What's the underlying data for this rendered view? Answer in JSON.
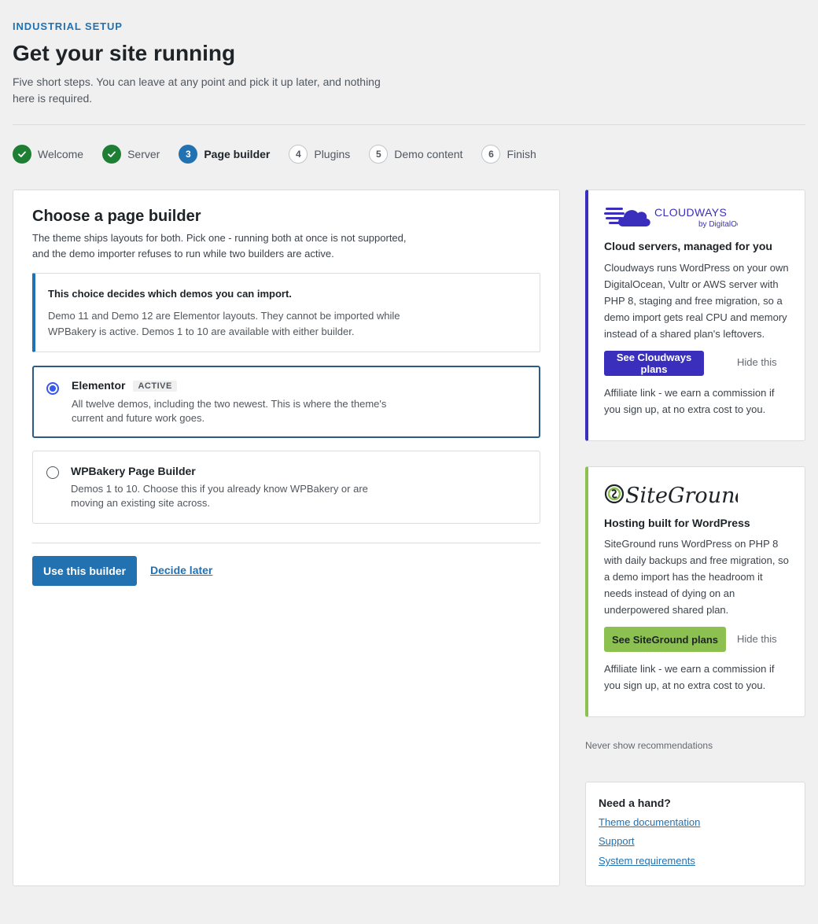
{
  "header": {
    "eyebrow": "INDUSTRIAL SETUP",
    "title": "Get your site running",
    "subtitle": "Five short steps. You can leave at any point and pick it up later, and nothing here is required."
  },
  "steps": [
    {
      "number": "1",
      "label": "Welcome",
      "status": "done"
    },
    {
      "number": "2",
      "label": "Server",
      "status": "done"
    },
    {
      "number": "3",
      "label": "Page builder",
      "status": "current"
    },
    {
      "number": "4",
      "label": "Plugins",
      "status": "todo"
    },
    {
      "number": "5",
      "label": "Demo content",
      "status": "todo"
    },
    {
      "number": "6",
      "label": "Finish",
      "status": "todo"
    }
  ],
  "main": {
    "title": "Choose a page builder",
    "intro": "The theme ships layouts for both. Pick one - running both at once is not supported, and the demo importer refuses to run while two builders are active.",
    "notice": {
      "title": "This choice decides which demos you can import.",
      "body": "Demo 11 and Demo 12 are Elementor layouts. They cannot be imported while WPBakery is active. Demos 1 to 10 are available with either builder."
    },
    "options": [
      {
        "title": "Elementor",
        "badge": "ACTIVE",
        "description": "All twelve demos, including the two newest. This is where the theme's current and future work goes.",
        "selected": true
      },
      {
        "title": "WPBakery Page Builder",
        "badge": "",
        "description": "Demos 1 to 10. Choose this if you already know WPBakery or are moving an existing site across.",
        "selected": false
      }
    ],
    "primary_button": "Use this builder",
    "secondary_link": "Decide later"
  },
  "promos": {
    "cloudways": {
      "logo_text": "CLOUDWAYS",
      "logo_sub": "by DigitalOcean",
      "title": "Cloud servers, managed for you",
      "body": "Cloudways runs WordPress on your own DigitalOcean, Vultr or AWS server with PHP 8, staging and free migration, so a demo import gets real CPU and memory instead of a shared plan's leftovers.",
      "button": "See Cloudways plans",
      "hide": "Hide this",
      "fine": "Affiliate link - we earn a commission if you sign up, at no extra cost to you."
    },
    "siteground": {
      "logo_text": "SiteGround",
      "title": "Hosting built for WordPress",
      "body": "SiteGround runs WordPress on PHP 8 with daily backups and free migration, so a demo import has the headroom it needs instead of dying on an underpowered shared plan.",
      "button": "See SiteGround plans",
      "hide": "Hide this",
      "fine": "Affiliate link - we earn a commission if you sign up, at no extra cost to you."
    }
  },
  "never_show": "Never show recommendations",
  "help": {
    "title": "Need a hand?",
    "links": [
      "Theme documentation",
      "Support",
      "System requirements"
    ]
  },
  "colors": {
    "accent": "#2271b1",
    "done": "#1e7e34",
    "cloudways": "#3a2fbd",
    "siteground": "#8cc152",
    "radio": "#3858e9"
  },
  "icons": {
    "done_step": "check-icon"
  }
}
